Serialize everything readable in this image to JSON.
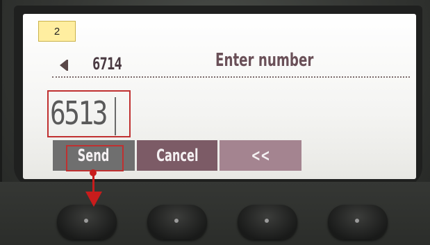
{
  "step_badge": "2",
  "phone": {
    "line_number": "6714",
    "screen_title": "Enter number",
    "entered_number": "6513",
    "softkeys": [
      {
        "label": "Send"
      },
      {
        "label": "Cancel"
      },
      {
        "label": "<<"
      }
    ],
    "hardware_keys": 4
  },
  "annotation": {
    "highlight_color": "#c03030",
    "arrow_color": "#c81c1c",
    "badge_color": "#ffeea0"
  }
}
